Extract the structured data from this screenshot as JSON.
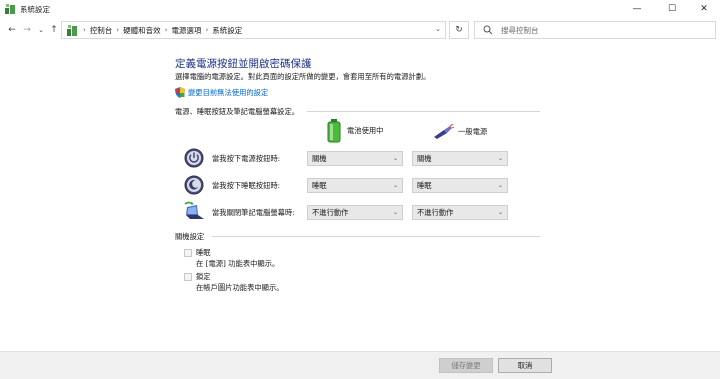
{
  "window": {
    "title": "系統設定",
    "minimize": "—",
    "maximize": "☐",
    "close": "✕"
  },
  "nav": {
    "back": "←",
    "forward": "→",
    "recent": "⌄",
    "up": "↑",
    "refresh": "↻",
    "breadcrumbs": [
      "控制台",
      "硬體和音效",
      "電源選項",
      "系統設定"
    ],
    "separator": "›",
    "address_dropdown": "⌄",
    "search_placeholder": "搜尋控制台"
  },
  "main": {
    "heading": "定義電源按鈕並開啟密碼保護",
    "description": "選擇電腦的電源設定。對此頁面的設定所做的變更，會套用至所有的電源計劃。",
    "change_link": "變更目前無法使用的設定",
    "power_section_title": "電源、睡眠按鈕及筆記電腦螢幕設定。",
    "columns": {
      "battery": "電池使用中",
      "plugged": "一般電源"
    },
    "rows": [
      {
        "label": "當我按下電源按鈕時:",
        "battery": "關機",
        "plugged": "關機",
        "icon": "power-button-icon"
      },
      {
        "label": "當我按下睡眠按鈕時:",
        "battery": "睡眠",
        "plugged": "睡眠",
        "icon": "sleep-button-icon"
      },
      {
        "label": "當我關閉筆記電腦螢幕時:",
        "battery": "不進行動作",
        "plugged": "不進行動作",
        "icon": "laptop-lid-icon"
      }
    ],
    "shutdown_section_title": "關機設定",
    "options": [
      {
        "label": "睡眠",
        "desc": "在 [電源] 功能表中顯示。"
      },
      {
        "label": "鎖定",
        "desc": "在帳戶圖片功能表中顯示。"
      }
    ]
  },
  "footer": {
    "save": "儲存變更",
    "cancel": "取消"
  },
  "colors": {
    "heading": "#1e3287",
    "link": "#0066cc",
    "footer_bg": "#f0f0f0"
  }
}
